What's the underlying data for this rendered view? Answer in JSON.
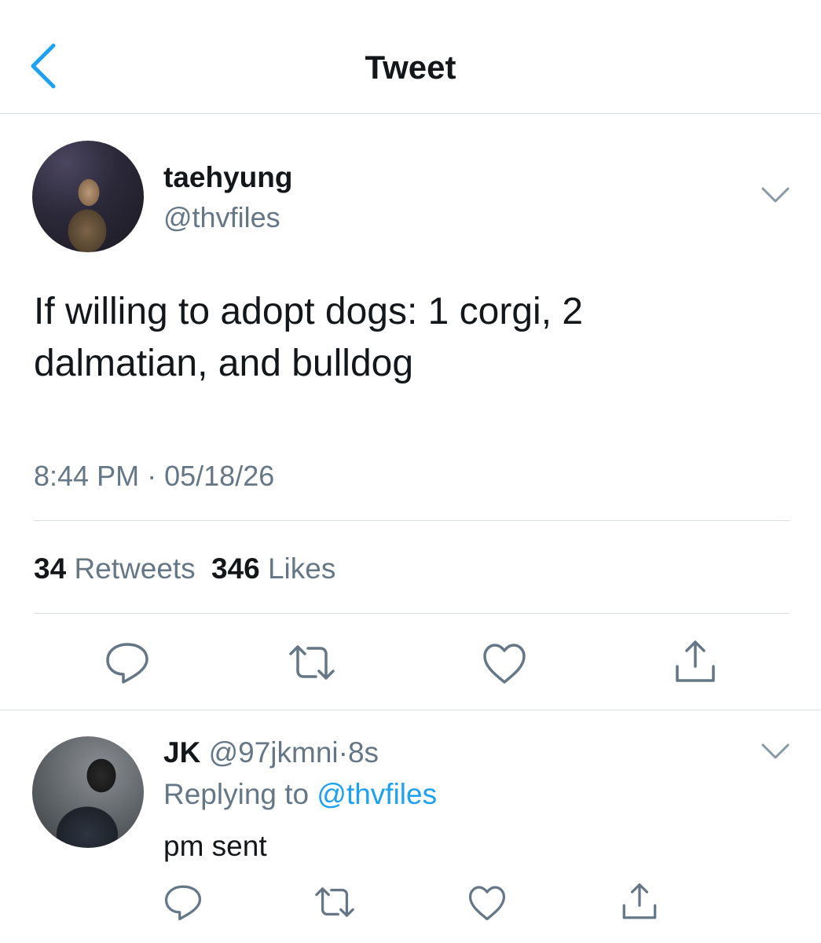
{
  "header": {
    "back_icon": "chevron-left-icon",
    "title": "Tweet"
  },
  "colors": {
    "accent": "#1da1f2",
    "secondary_text": "#657786",
    "primary_text": "#14171a",
    "divider": "#d8dde2"
  },
  "tweet": {
    "display_name": "taehyung",
    "handle": "@thvfiles",
    "text": "If willing to adopt dogs: 1 corgi, 2 dalmatian, and bulldog",
    "time": "8:44 PM",
    "separator": "·",
    "date": "05/18/26",
    "retweets_count": "34",
    "retweets_label": "Retweets",
    "likes_count": "346",
    "likes_label": "Likes",
    "actions": [
      "reply-icon",
      "retweet-icon",
      "like-icon",
      "share-icon"
    ]
  },
  "reply": {
    "display_name": "JK",
    "handle": "@97jkmni",
    "separator": "·",
    "time_ago": "8s",
    "replying_label": "Replying to",
    "replying_to": "@thvfiles",
    "text": "pm sent",
    "actions": [
      "reply-icon",
      "retweet-icon",
      "like-icon",
      "share-icon"
    ]
  }
}
